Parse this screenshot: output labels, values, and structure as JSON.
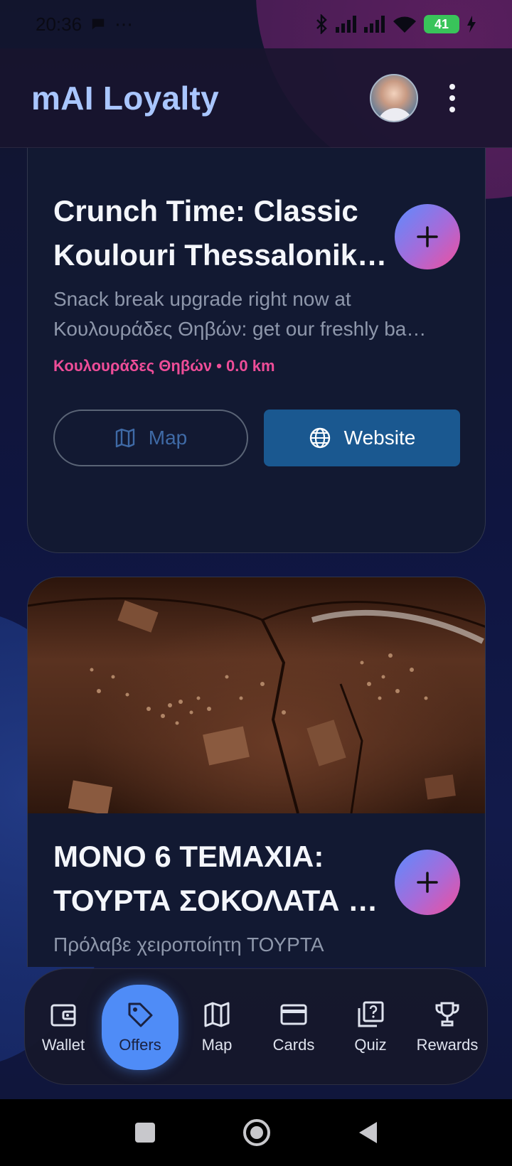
{
  "status_bar": {
    "time": "20:36",
    "extra": "⋯",
    "battery": "41"
  },
  "app_bar": {
    "title": "mAI Loyalty",
    "avatar": "avatar",
    "menu_icon": "more-vert-icon"
  },
  "offers": [
    {
      "title_lines": [
        "Crunch Time: Classic",
        "Koulouri Thessaloniki…"
      ],
      "description_lines": [
        "Snack break upgrade right now at",
        "Κουλουράδες Θηβών: get our freshly ba…"
      ],
      "merchant_line": "Κουλουράδες Θηβών • 0.0 km",
      "map_label": "Map",
      "website_label": "Website"
    },
    {
      "title_lines": [
        "ΜΟΝΟ 6 ΤΕΜΑΧΙΑ:",
        "ΤΟΥΡΤΑ ΣΟΚΟΛΑΤΑ σ…"
      ],
      "description_lines": [
        "Πρόλαβε χειροποίητη ΤΟΥΡΤΑ"
      ]
    }
  ],
  "bottom_nav": {
    "items": [
      {
        "label": "Wallet",
        "icon": "wallet-icon"
      },
      {
        "label": "Offers",
        "icon": "tag-icon",
        "active": true
      },
      {
        "label": "Map",
        "icon": "map-icon"
      },
      {
        "label": "Cards",
        "icon": "credit-card-icon"
      },
      {
        "label": "Quiz",
        "icon": "quiz-icon"
      },
      {
        "label": "Rewards",
        "icon": "trophy-icon"
      }
    ]
  },
  "colors": {
    "accent": "#4f8cf7",
    "title": "#a9c6ff",
    "merchant": "#ee4d98",
    "website_button": "#1a5890"
  }
}
